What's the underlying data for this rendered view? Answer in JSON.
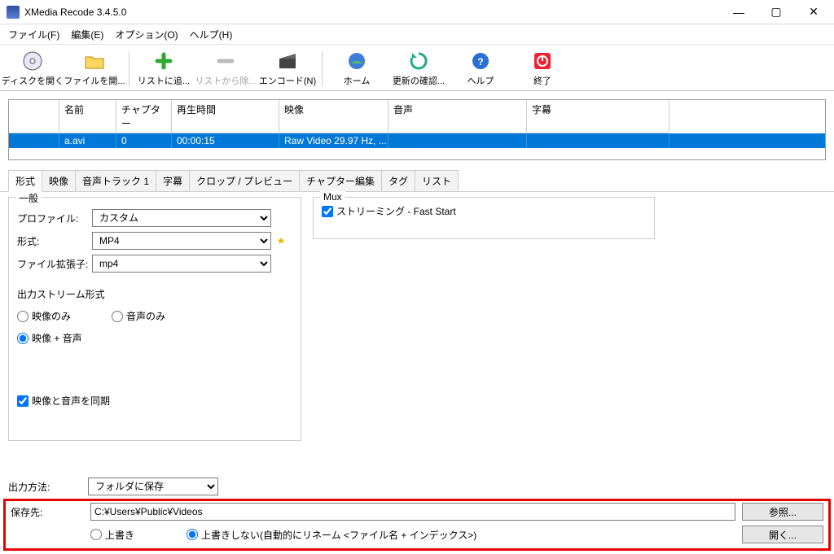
{
  "titlebar": {
    "title": "XMedia Recode 3.4.5.0"
  },
  "menubar": {
    "file": "ファイル(F)",
    "edit": "編集(E)",
    "options": "オプション(O)",
    "help": "ヘルプ(H)"
  },
  "toolbar": {
    "open_disc": "ディスクを開く",
    "open_file": "ファイルを開...",
    "add_list": "リストに追...",
    "remove_list": "リストから除...",
    "encode": "エンコード(N)",
    "home": "ホーム",
    "check_update": "更新の確認...",
    "help": "ヘルプ",
    "quit": "終了"
  },
  "table": {
    "headers": {
      "name": "名前",
      "chapter": "チャプター",
      "playtime": "再生時間",
      "video": "映像",
      "audio": "音声",
      "subtitle": "字幕"
    },
    "row": {
      "name": "a.avi",
      "chapter": "0",
      "playtime": "00:00:15",
      "video": "Raw Video 29.97 Hz, ...",
      "audio": "",
      "subtitle": ""
    }
  },
  "tabs": {
    "format": "形式",
    "video": "映像",
    "audio_track": "音声トラック 1",
    "subtitle": "字幕",
    "crop": "クロップ / プレビュー",
    "chapter": "チャプター編集",
    "tag": "タグ",
    "list": "リスト"
  },
  "general": {
    "legend": "一般",
    "profile_label": "プロファイル:",
    "profile_value": "カスタム",
    "format_label": "形式:",
    "format_value": "MP4",
    "ext_label": "ファイル拡張子:",
    "ext_value": "mp4",
    "stream_legend": "出力ストリーム形式",
    "video_only": "映像のみ",
    "audio_only": "音声のみ",
    "video_audio": "映像 + 音声",
    "sync": "映像と音声を同期"
  },
  "mux": {
    "legend": "Mux",
    "streaming": "ストリーミング - Fast Start"
  },
  "output": {
    "method_label": "出力方法:",
    "method_value": "フォルダに保存",
    "dest_label": "保存先:",
    "dest_path": "C:¥Users¥Public¥Videos",
    "browse": "参照...",
    "open": "開く...",
    "overwrite": "上書き",
    "no_overwrite": "上書きしない(自動的にリネーム <ファイル名 + インデックス>)"
  }
}
